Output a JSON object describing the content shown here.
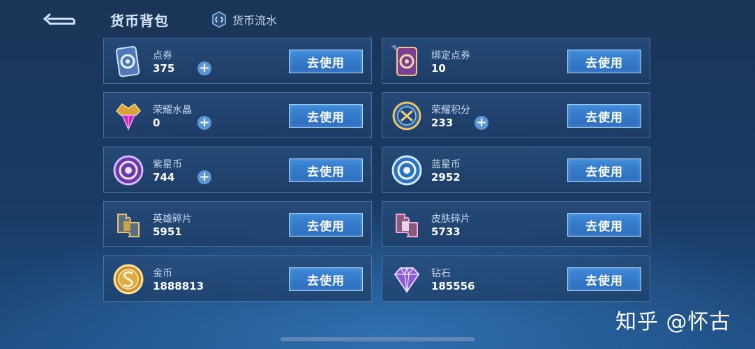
{
  "header": {
    "title": "货币背包",
    "tab_flow_label": "货币流水"
  },
  "button_label": "去使用",
  "items": [
    {
      "name": "点券",
      "amount": "375",
      "icon": "voucher-card-icon",
      "has_plus": true
    },
    {
      "name": "绑定点券",
      "amount": "10",
      "icon": "bound-voucher-card-icon",
      "has_plus": false
    },
    {
      "name": "荣耀水晶",
      "amount": "0",
      "icon": "glory-crystal-icon",
      "has_plus": true
    },
    {
      "name": "荣耀积分",
      "amount": "233",
      "icon": "glory-points-icon",
      "has_plus": true
    },
    {
      "name": "紫星币",
      "amount": "744",
      "icon": "purple-star-coin-icon",
      "has_plus": true
    },
    {
      "name": "蓝星币",
      "amount": "2952",
      "icon": "blue-star-coin-icon",
      "has_plus": false
    },
    {
      "name": "英雄碎片",
      "amount": "5951",
      "icon": "hero-fragment-icon",
      "has_plus": false
    },
    {
      "name": "皮肤碎片",
      "amount": "5733",
      "icon": "skin-fragment-icon",
      "has_plus": false
    },
    {
      "name": "金币",
      "amount": "1888813",
      "icon": "gold-coin-icon",
      "has_plus": false
    },
    {
      "name": "钻石",
      "amount": "185556",
      "icon": "diamond-icon",
      "has_plus": false
    }
  ],
  "watermark": "知乎 @怀古",
  "colors": {
    "button_blue": "#3f8ad8",
    "card_border": "#78aae1",
    "plus_blue": "#5b97d6"
  }
}
